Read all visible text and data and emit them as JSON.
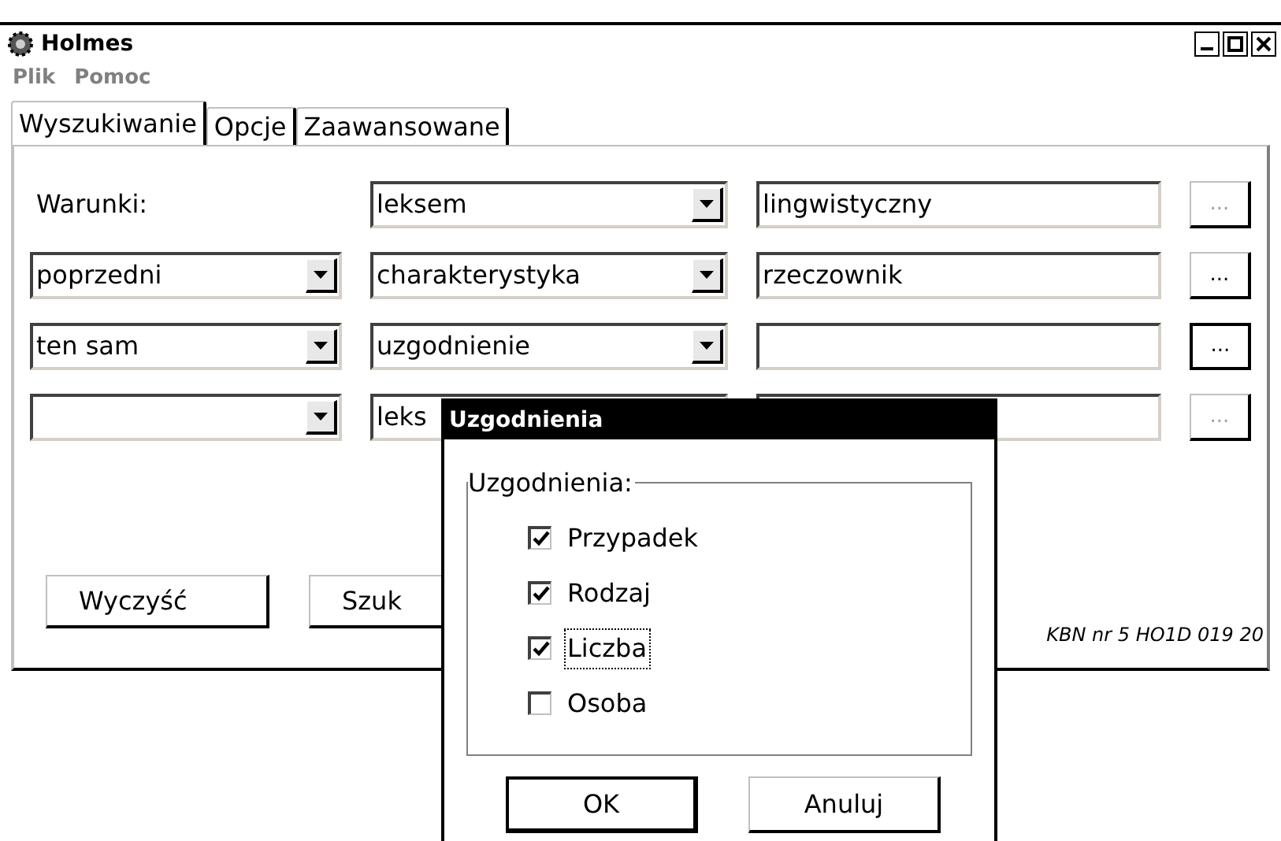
{
  "window": {
    "title": "Holmes"
  },
  "menu": [
    "Plik",
    "Pomoc"
  ],
  "tabs": [
    {
      "label": "Wyszukiwanie",
      "selected": true
    },
    {
      "label": "Opcje",
      "selected": false
    },
    {
      "label": "Zaawansowane",
      "selected": false
    }
  ],
  "rows": [
    {
      "lead": {
        "kind": "label",
        "text": "Warunki:"
      },
      "type": "leksem",
      "type_arrow": true,
      "value": "lingwistyczny",
      "button": {
        "label": "...",
        "disabled": true,
        "focused": false
      }
    },
    {
      "lead": {
        "kind": "combo",
        "text": "poprzedni"
      },
      "type": "charakterystyka",
      "type_arrow": true,
      "value": "rzeczownik",
      "button": {
        "label": "...",
        "disabled": false,
        "focused": false
      }
    },
    {
      "lead": {
        "kind": "combo",
        "text": "ten sam"
      },
      "type": "uzgodnienie",
      "type_arrow": true,
      "button": {
        "label": "...",
        "disabled": false,
        "focused": true
      }
    },
    {
      "lead": {
        "kind": "combo"
      },
      "type": "leks",
      "type_arrow": false,
      "button": {
        "label": "...",
        "disabled": true,
        "focused": false
      }
    }
  ],
  "buttons": [
    "Wyczyść",
    "Szuk"
  ],
  "footer": "KBN nr 5 HO1D 019 20",
  "dialog": {
    "title": "Uzgodnienia",
    "group": "Uzgodnienia:",
    "options": [
      {
        "label": "Przypadek",
        "checked": true,
        "focused": false
      },
      {
        "label": "Rodzaj",
        "checked": true,
        "focused": false
      },
      {
        "label": "Liczba",
        "checked": true,
        "focused": true
      },
      {
        "label": "Osoba",
        "checked": false,
        "focused": false
      }
    ],
    "buttons": [
      {
        "label": "OK",
        "default": true
      },
      {
        "label": "Anuluj",
        "default": false
      }
    ]
  }
}
